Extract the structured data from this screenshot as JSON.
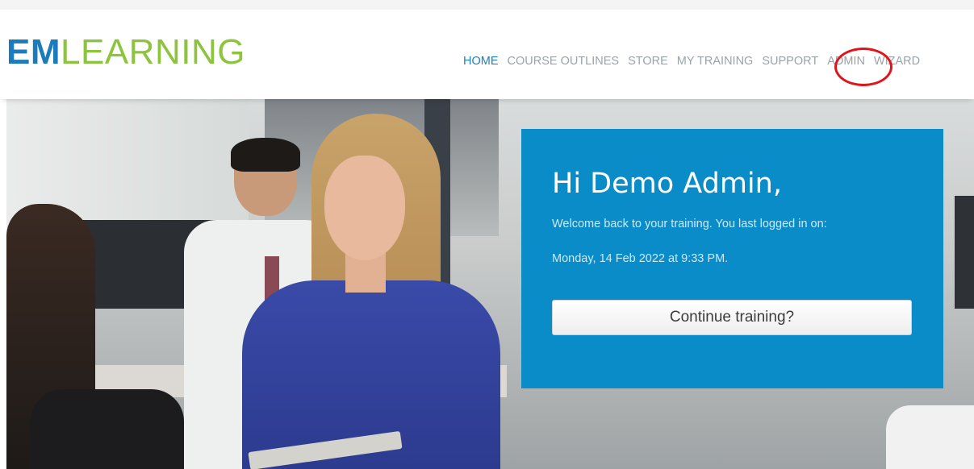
{
  "brand": {
    "logo_bold": "EM",
    "logo_light": "LEARNING",
    "bold_color": "#1b7bbd",
    "light_color": "#8cc43e"
  },
  "nav": {
    "items": [
      {
        "label": "HOME",
        "active": true
      },
      {
        "label": "COURSE OUTLINES",
        "active": false
      },
      {
        "label": "STORE",
        "active": false
      },
      {
        "label": "MY TRAINING",
        "active": false
      },
      {
        "label": "SUPPORT",
        "active": false
      },
      {
        "label": "ADMIN",
        "active": false,
        "highlighted": true
      },
      {
        "label": "WIZARD",
        "active": false
      }
    ]
  },
  "welcome": {
    "greeting": "Hi Demo Admin,",
    "message": "Welcome back to your training. You last logged in on:",
    "last_login": "Monday, 14 Feb 2022 at 9:33 PM.",
    "button_label": "Continue training?",
    "card_color": "#0a8cc9"
  },
  "annotation": {
    "ring_color": "#e0141b"
  }
}
